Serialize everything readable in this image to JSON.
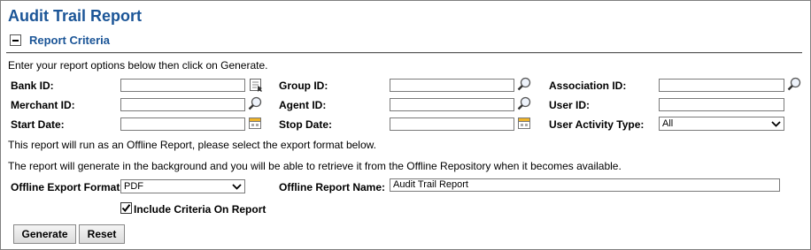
{
  "page": {
    "title": "Audit Trail Report",
    "section_title": "Report Criteria",
    "instructions": "Enter your report options below then click on Generate.",
    "offline_note": "This report will run as an Offline Report, please select the export format below.",
    "background_note": "The report will generate in the background and you will be able to retrieve it from the Offline Repository when it becomes available."
  },
  "fields": {
    "bank_id": {
      "label": "Bank ID:",
      "value": ""
    },
    "group_id": {
      "label": "Group ID:",
      "value": ""
    },
    "association_id": {
      "label": "Association ID:",
      "value": ""
    },
    "merchant_id": {
      "label": "Merchant ID:",
      "value": ""
    },
    "agent_id": {
      "label": "Agent ID:",
      "value": ""
    },
    "user_id": {
      "label": "User ID:",
      "value": ""
    },
    "start_date": {
      "label": "Start Date:",
      "value": ""
    },
    "stop_date": {
      "label": "Stop Date:",
      "value": ""
    },
    "user_activity_type": {
      "label": "User Activity Type:",
      "value": "All"
    },
    "offline_export_format": {
      "label": "Offline Export Format:",
      "value": "PDF"
    },
    "offline_report_name": {
      "label": "Offline Report Name:",
      "value": "Audit Trail Report"
    },
    "include_criteria": {
      "label": "Include Criteria On Report",
      "checked": true
    }
  },
  "buttons": {
    "generate": "Generate",
    "reset": "Reset"
  },
  "icons": {
    "toggle": "collapse-icon",
    "lookup": "magnifier-icon",
    "list": "list-picker-icon",
    "calendar": "calendar-icon"
  },
  "colors": {
    "title": "#1b5597",
    "border": "#7f7f7f"
  }
}
